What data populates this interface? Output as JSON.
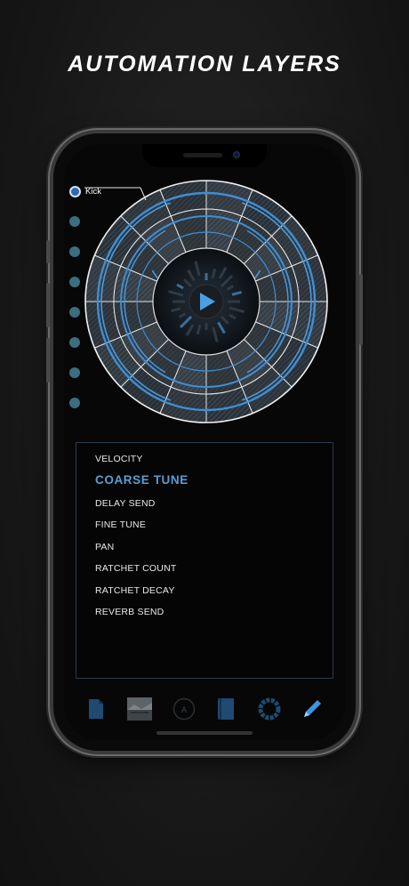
{
  "headline": "AUTOMATION LAYERS",
  "tracks": {
    "active_label": "Kick"
  },
  "player": {
    "play_icon": "play-icon"
  },
  "parameters": [
    {
      "label": "VELOCITY",
      "selected": false
    },
    {
      "label": "COARSE TUNE",
      "selected": true
    },
    {
      "label": "DELAY SEND",
      "selected": false
    },
    {
      "label": "FINE TUNE",
      "selected": false
    },
    {
      "label": "PAN",
      "selected": false
    },
    {
      "label": "RATCHET COUNT",
      "selected": false
    },
    {
      "label": "RATCHET DECAY",
      "selected": false
    },
    {
      "label": "REVERB SEND",
      "selected": false
    }
  ],
  "toolbar": {
    "icons": [
      "file-icon",
      "image-thumbnail",
      "a-circle-icon",
      "book-icon",
      "ring-icon",
      "pencil-icon"
    ]
  },
  "colors": {
    "accent": "#5a9ed6",
    "track_dot": "#3b6e7e",
    "background": "#1c1c1c"
  }
}
